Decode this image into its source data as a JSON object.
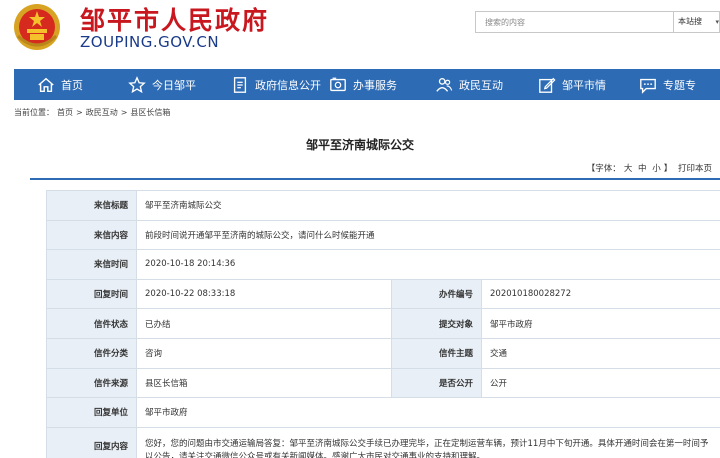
{
  "header": {
    "site_name": "邹平市人民政府",
    "domain": "ZOUPING.GOV.CN",
    "emblem_icon": "national-emblem-icon",
    "search": {
      "placeholder": "搜索的内容",
      "scope": "本站搜"
    }
  },
  "nav": {
    "items": [
      {
        "label": "首页",
        "icon": "home-icon"
      },
      {
        "label": "今日邹平",
        "icon": "star-icon"
      },
      {
        "label": "政府信息公开",
        "icon": "document-icon"
      },
      {
        "label": "办事服务",
        "icon": "id-card-icon"
      },
      {
        "label": "政民互动",
        "icon": "people-icon"
      },
      {
        "label": "邹平市情",
        "icon": "edit-icon"
      },
      {
        "label": "专题专",
        "icon": "chat-icon"
      }
    ]
  },
  "breadcrumb": {
    "prefix": "当前位置：",
    "items": [
      "首页",
      "政民互动",
      "县区长信箱"
    ],
    "separator": ">"
  },
  "article": {
    "title": "邹平至济南城际公交",
    "font_label": "【字体：",
    "font_large": "大",
    "font_medium": "中",
    "font_small": "小",
    "font_close": "】",
    "print_label": "打印本页"
  },
  "letter": {
    "subject_label": "来信标题",
    "subject": "邹平至济南城际公交",
    "content_label": "来信内容",
    "content": "前段时间说开通邹平至济南的城际公交，请问什么时候能开通",
    "sent_time_label": "来信时间",
    "sent_time": "2020-10-18 20:14:36",
    "reply_time_label": "回复时间",
    "reply_time": "2020-10-22 08:33:18",
    "case_no_label": "办件编号",
    "case_no": "202010180028272",
    "status_label": "信件状态",
    "status": "已办结",
    "target_label": "提交对象",
    "target": "邹平市政府",
    "category_label": "信件分类",
    "category": "咨询",
    "topic_label": "信件主题",
    "topic": "交通",
    "source_label": "信件来源",
    "source": "县区长信箱",
    "public_label": "是否公开",
    "public": "公开",
    "reply_unit_label": "回复单位",
    "reply_unit": "邹平市政府",
    "reply_content_label": "回复内容",
    "reply_content": "您好，您的问题由市交通运输局答复：邹平至济南城际公交手续已办理完毕，正在定制运营车辆，预计11月中下旬开通。具体开通时间会在第一时间予以公告，请关注交通微信公众号或有关新闻媒体。感谢广大市民对交通事业的支持和理解。"
  },
  "colors": {
    "brand_red": "#c8171e",
    "domain_blue": "#1a3a8a",
    "nav_blue": "#2d6bb5",
    "label_bg": "#e9eff6"
  }
}
